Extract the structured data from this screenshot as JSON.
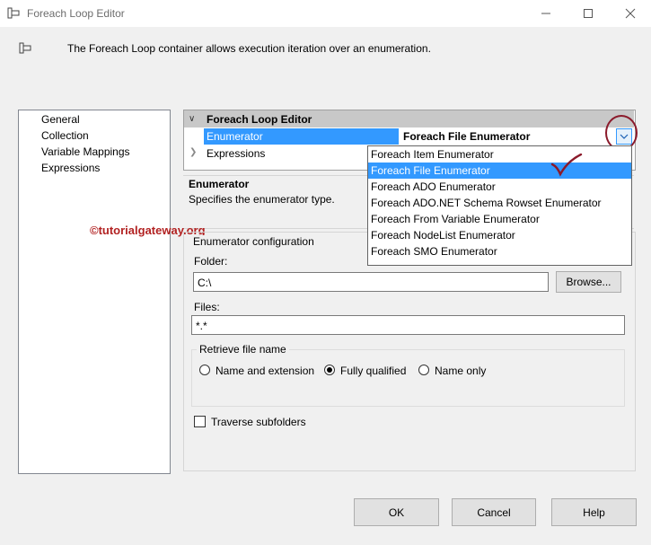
{
  "window": {
    "title": "Foreach Loop Editor"
  },
  "header": {
    "text": "The Foreach Loop container allows execution iteration over an enumeration."
  },
  "nav": {
    "items": [
      "General",
      "Collection",
      "Variable Mappings",
      "Expressions"
    ]
  },
  "grid": {
    "category": "Foreach Loop Editor",
    "enumerator_label": "Enumerator",
    "enumerator_value": "Foreach File Enumerator",
    "expressions_label": "Expressions"
  },
  "dropdown": {
    "options": [
      "Foreach Item Enumerator",
      "Foreach File Enumerator",
      "Foreach ADO Enumerator",
      "Foreach ADO.NET Schema Rowset Enumerator",
      "Foreach From Variable Enumerator",
      "Foreach NodeList Enumerator",
      "Foreach SMO Enumerator"
    ],
    "selected": "Foreach File Enumerator"
  },
  "description": {
    "title": "Enumerator",
    "text": "Specifies the enumerator type."
  },
  "watermark": "©tutorialgateway.org",
  "config": {
    "legend": "Enumerator configuration",
    "folder_label": "Folder:",
    "folder_value": "C:\\",
    "browse_label": "Browse...",
    "files_label": "Files:",
    "files_value": "*.*",
    "retrieve_legend": "Retrieve file name",
    "radios": [
      "Name and extension",
      "Fully qualified",
      "Name only"
    ],
    "radio_selected": "Fully qualified",
    "traverse_label": "Traverse subfolders",
    "traverse_checked": false
  },
  "buttons": {
    "ok": "OK",
    "cancel": "Cancel",
    "help": "Help"
  },
  "colors": {
    "selection": "#3399ff",
    "annotation": "#8b1a2b",
    "watermark": "#b22222"
  }
}
